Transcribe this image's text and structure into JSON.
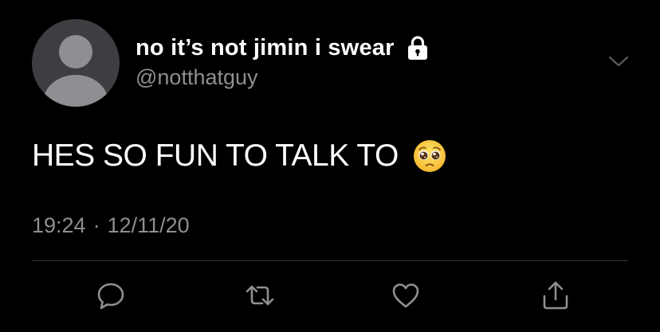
{
  "tweet": {
    "display_name": "no it’s not jimin i swear",
    "handle": "@notthatguy",
    "text": "HES SO FUN TO TALK TO",
    "time": "19:24",
    "separator": "·",
    "date": "12/11/20"
  },
  "icons": {
    "lock": "lock-icon",
    "chevron": "chevron-down-icon",
    "emoji": "pleading-face-emoji",
    "reply": "reply-icon",
    "retweet": "retweet-icon",
    "like": "heart-icon",
    "share": "share-icon"
  },
  "colors": {
    "background": "#000000",
    "primary_text": "#ffffff",
    "secondary_text": "#8e8e93",
    "divider": "#2f3336",
    "avatar_bg": "#3e3e42",
    "avatar_fg": "#8e8e93"
  }
}
